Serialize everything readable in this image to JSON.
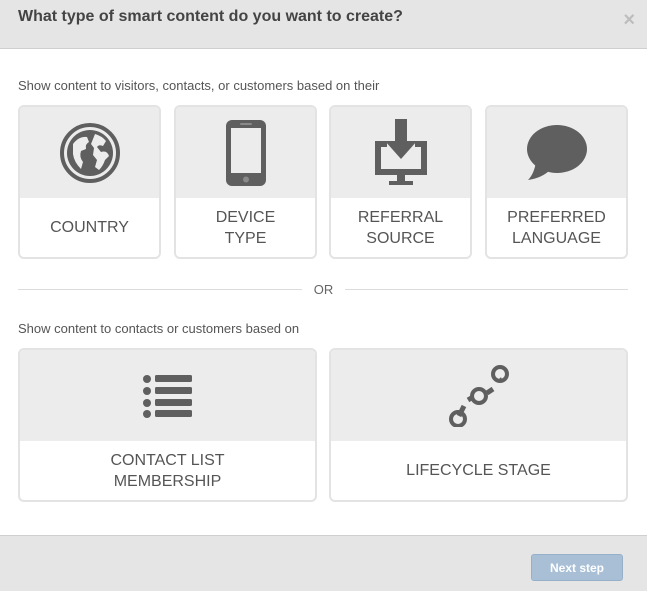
{
  "header": {
    "title": "What type of smart content do you want to create?",
    "close_glyph": "×"
  },
  "section1": {
    "label": "Show content to visitors, contacts, or customers based on their",
    "cards": [
      {
        "label_line1": "COUNTRY",
        "label_line2": "",
        "icon": "globe-icon"
      },
      {
        "label_line1": "DEVICE",
        "label_line2": "TYPE",
        "icon": "smartphone-icon"
      },
      {
        "label_line1": "REFERRAL",
        "label_line2": "SOURCE",
        "icon": "download-monitor-icon"
      },
      {
        "label_line1": "PREFERRED",
        "label_line2": "LANGUAGE",
        "icon": "speech-bubble-icon"
      }
    ]
  },
  "divider": {
    "text": "OR"
  },
  "section2": {
    "label": "Show content to contacts or customers based on",
    "cards": [
      {
        "label_line1": "CONTACT LIST",
        "label_line2": "MEMBERSHIP",
        "icon": "list-icon"
      },
      {
        "label_line1": "LIFECYCLE STAGE",
        "label_line2": "",
        "icon": "stage-path-icon"
      }
    ]
  },
  "footer": {
    "next_label": "Next step"
  },
  "colors": {
    "header_bg": "#e5e5e5",
    "card_icon_bg": "#ececec",
    "icon_color": "#5f5f5f",
    "button_bg": "#a8bfd6"
  }
}
